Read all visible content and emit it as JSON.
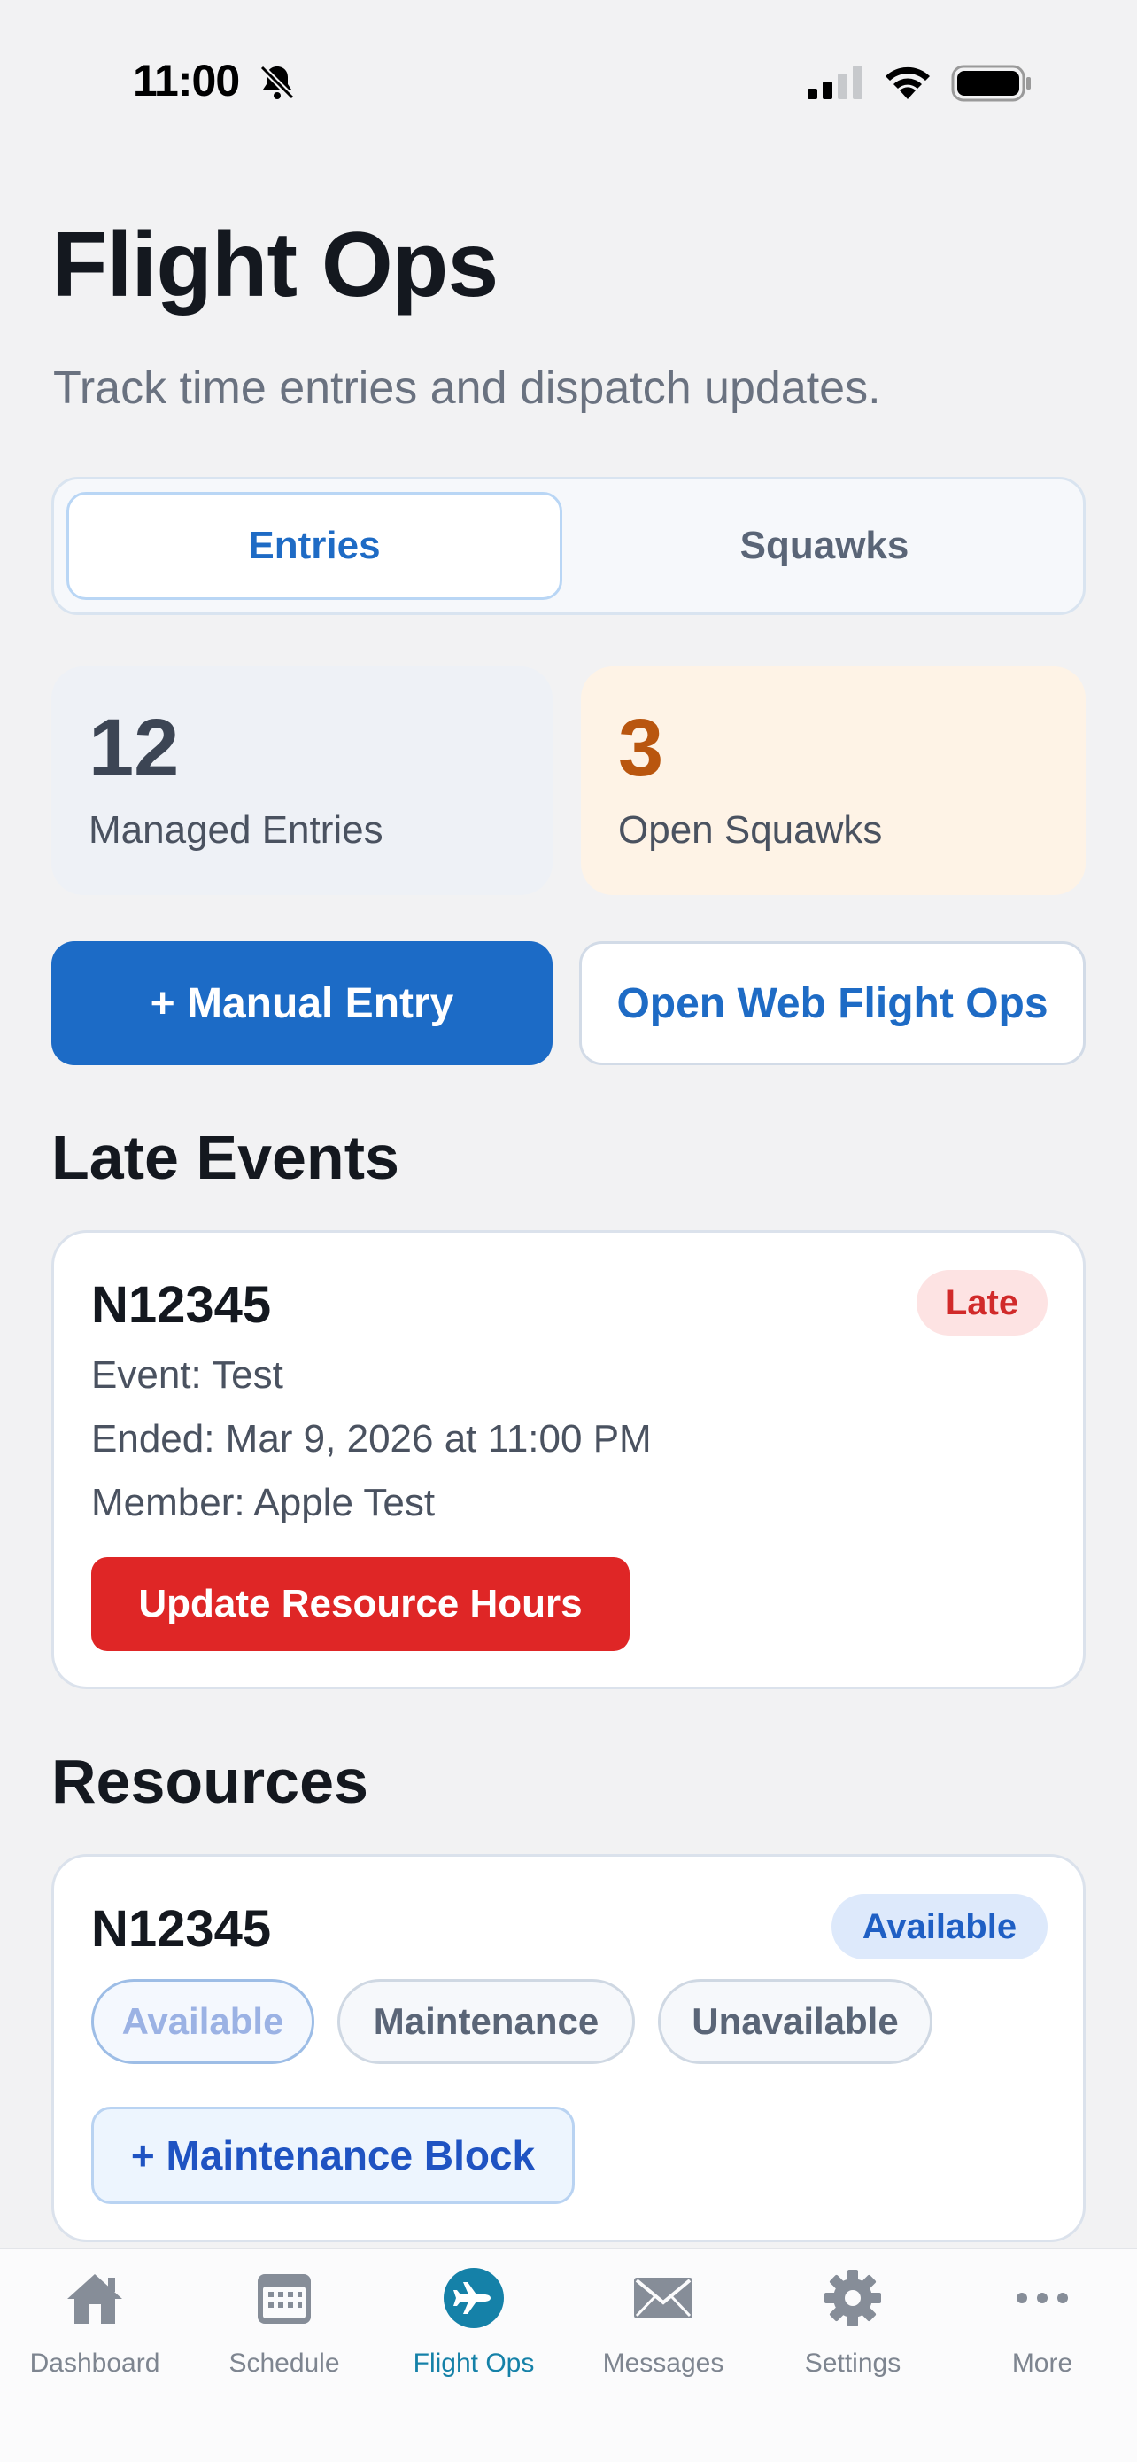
{
  "status_bar": {
    "time": "11:00"
  },
  "header": {
    "title": "Flight Ops",
    "subtitle": "Track time entries and dispatch updates."
  },
  "segments": {
    "entries": "Entries",
    "squawks": "Squawks"
  },
  "stats": {
    "managed": {
      "value": "12",
      "label": "Managed Entries"
    },
    "squawks": {
      "value": "3",
      "label": "Open Squawks"
    }
  },
  "actions": {
    "manual_entry": "+ Manual Entry",
    "open_web": "Open Web Flight Ops"
  },
  "late_events": {
    "title": "Late Events",
    "card": {
      "tail": "N12345",
      "badge": "Late",
      "event": "Event: Test",
      "ended": "Ended: Mar 9, 2026 at 11:00 PM",
      "member": "Member: Apple Test",
      "button": "Update Resource Hours"
    }
  },
  "resources": {
    "title": "Resources",
    "card": {
      "tail": "N12345",
      "badge": "Available",
      "chips": [
        "Available",
        "Maintenance",
        "Unavailable"
      ],
      "block_button": "+ Maintenance Block"
    }
  },
  "tabs": [
    {
      "label": "Dashboard",
      "icon": "home-icon"
    },
    {
      "label": "Schedule",
      "icon": "calendar-icon"
    },
    {
      "label": "Flight Ops",
      "icon": "airplane-icon",
      "active": true
    },
    {
      "label": "Messages",
      "icon": "envelope-icon"
    },
    {
      "label": "Settings",
      "icon": "gear-icon"
    },
    {
      "label": "More",
      "icon": "more-icon"
    }
  ],
  "colors": {
    "accent": "#1c6bc6",
    "danger": "#df2626",
    "warning": "#b9560f",
    "tab_active": "#1581a8"
  }
}
